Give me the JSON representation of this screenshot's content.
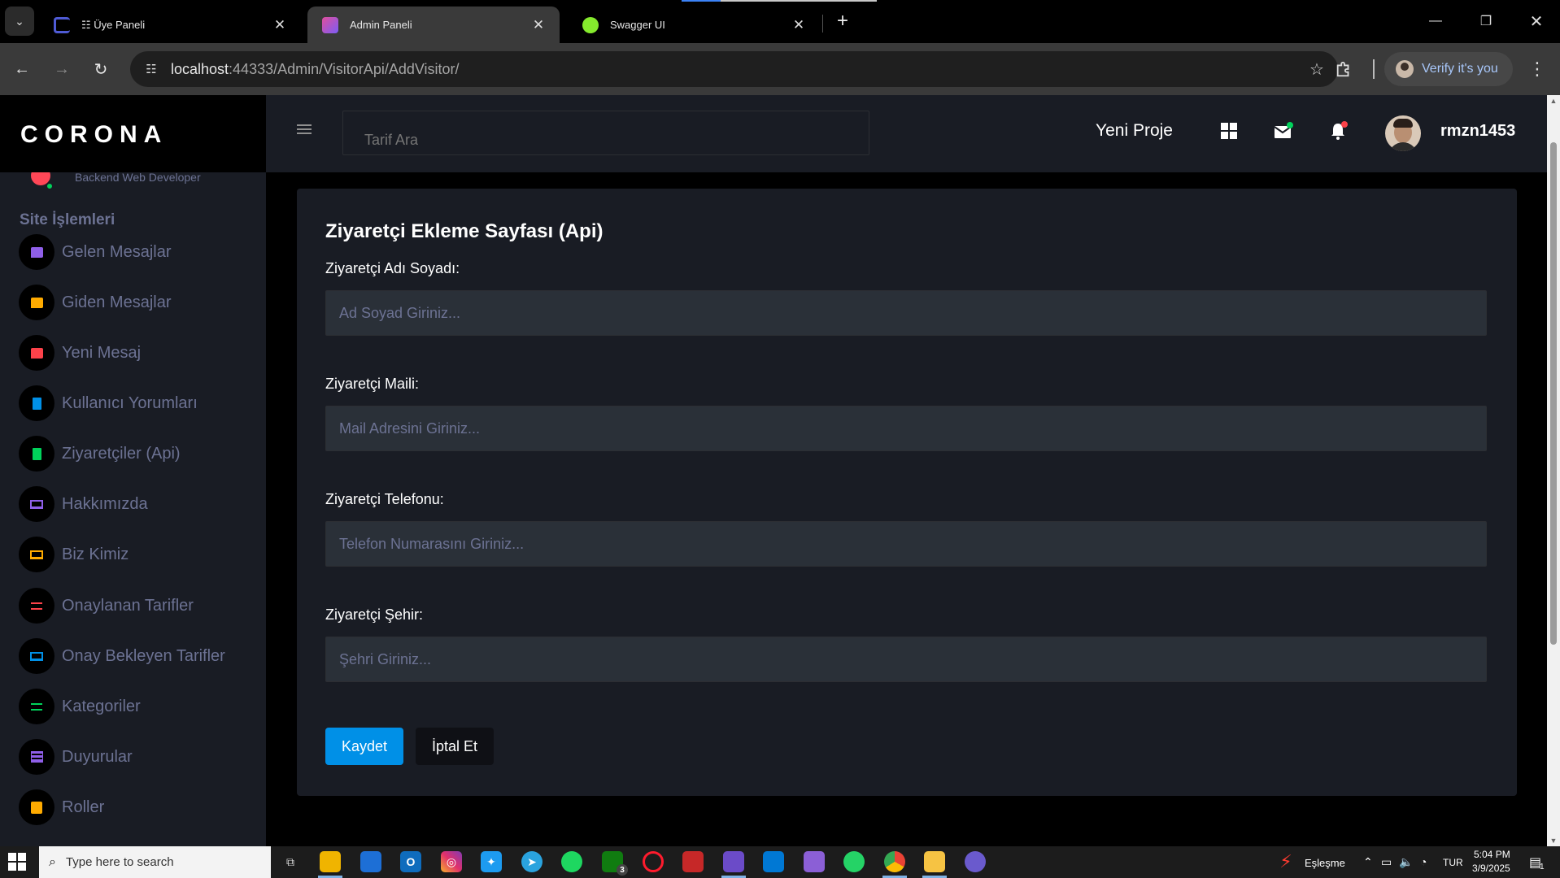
{
  "browser": {
    "tabs": [
      {
        "title": "☷ Üye Paneli",
        "favicon_color": "#4f5bd5",
        "active": false
      },
      {
        "title": "Admin Paneli",
        "favicon_color": "#8b5cf6",
        "active": true
      },
      {
        "title": "Swagger UI",
        "favicon_color": "#85ea2d",
        "active": false
      }
    ],
    "url_host": "localhost",
    "url_path": ":44333/Admin/VisitorApi/AddVisitor/",
    "verify_label": "Verify it's you"
  },
  "brand": "CORONA",
  "profile_subtitle": "Backend Web Developer",
  "sidebar": {
    "section_title": "Site İşlemleri",
    "items": [
      {
        "label": "Gelen Mesajlar",
        "icon": "message-icon",
        "color": "#8f5fe8"
      },
      {
        "label": "Giden Mesajlar",
        "icon": "message-icon",
        "color": "#ffab00"
      },
      {
        "label": "Yeni Mesaj",
        "icon": "message-icon",
        "color": "#fc424a"
      },
      {
        "label": "Kullanıcı Yorumları",
        "icon": "file-document-icon",
        "color": "#0090e7"
      },
      {
        "label": "Ziyaretçiler (Api)",
        "icon": "file-document-icon",
        "color": "#00d25b"
      },
      {
        "label": "Hakkımızda",
        "icon": "laptop-icon",
        "color": "#8f5fe8"
      },
      {
        "label": "Biz Kimiz",
        "icon": "laptop-icon",
        "color": "#ffab00"
      },
      {
        "label": "Onaylanan Tarifler",
        "icon": "playlist-play-icon",
        "color": "#fc424a"
      },
      {
        "label": "Onay Bekleyen Tarifler",
        "icon": "laptop-icon",
        "color": "#0090e7"
      },
      {
        "label": "Kategoriler",
        "icon": "playlist-play-icon",
        "color": "#00d25b"
      },
      {
        "label": "Duyurular",
        "icon": "table-icon",
        "color": "#8f5fe8"
      },
      {
        "label": "Roller",
        "icon": "contacts-icon",
        "color": "#ffab00"
      }
    ]
  },
  "navbar": {
    "search_placeholder": "Tarif Ara",
    "project_label": "Yeni Proje",
    "username": "rmzn1453"
  },
  "form": {
    "title": "Ziyaretçi Ekleme Sayfası (Api)",
    "fields": [
      {
        "label": "Ziyaretçi Adı Soyadı:",
        "placeholder": "Ad Soyad Giriniz...",
        "value": ""
      },
      {
        "label": "Ziyaretçi Maili:",
        "placeholder": "Mail Adresini Giriniz...",
        "value": ""
      },
      {
        "label": "Ziyaretçi Telefonu:",
        "placeholder": "Telefon Numarasını Giriniz...",
        "value": ""
      },
      {
        "label": "Ziyaretçi Şehir:",
        "placeholder": "Şehri Giriniz...",
        "value": ""
      }
    ],
    "save_label": "Kaydet",
    "cancel_label": "İptal Et"
  },
  "taskbar": {
    "search_placeholder": "Type here to search",
    "sync_label": "Eşleşme",
    "language": "TUR",
    "time": "5:04 PM",
    "date": "3/9/2025",
    "notification_count": "1",
    "xbox_badge": "3"
  },
  "colors": {
    "primary": "#0090e7",
    "sidebar_bg": "#191c24",
    "input_bg": "#2a3038",
    "muted_text": "#6c7293"
  }
}
